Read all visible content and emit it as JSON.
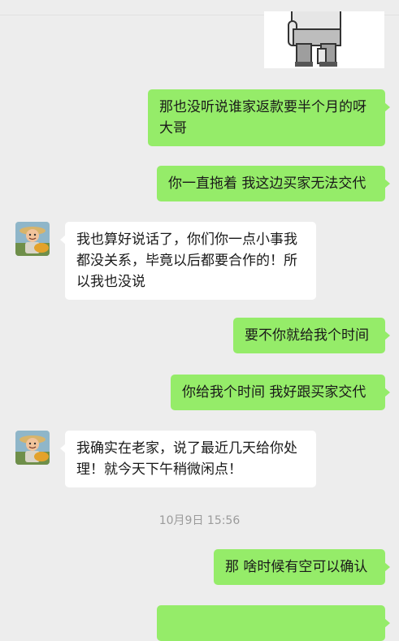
{
  "chat": {
    "messages": [
      {
        "side": "right",
        "text1": "那也没听说谁家返款要半个月的呀",
        "text2": "大哥"
      },
      {
        "side": "right",
        "text": "你一直拖着 我这边买家无法交代"
      },
      {
        "side": "left",
        "text1": "我也算好说话了，你们你一点小事我",
        "text2": "都没关系，毕竟以后都要合作的！所",
        "text3": "以我也没说"
      },
      {
        "side": "right",
        "text": "要不你就给我个时间"
      },
      {
        "side": "right",
        "text": "你给我个时间 我好跟买家交代"
      },
      {
        "side": "left",
        "text1": "我确实在老家，说了最近几天给你处",
        "text2": "理！就今天下午稍微闲点！"
      },
      {
        "side": "right",
        "text": "那 啥时候有空可以确认"
      }
    ],
    "timestamp": "10月9日 15:56"
  },
  "colors": {
    "background": "#ededed",
    "outgoing_bubble": "#95ec69",
    "incoming_bubble": "#ffffff"
  },
  "icons": [
    "sticker-image",
    "avatar-image"
  ]
}
